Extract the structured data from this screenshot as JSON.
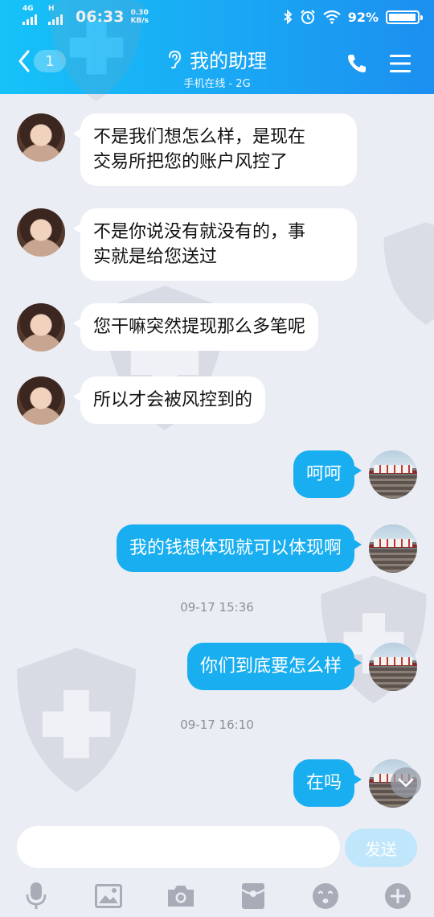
{
  "status_bar": {
    "network_type": "4G",
    "network_hd": "H",
    "time": "06:33",
    "speed_value": "0.30",
    "speed_unit": "KB/s",
    "battery_percent": "92%"
  },
  "header": {
    "back_badge": "1",
    "title": "我的助理",
    "subtitle": "手机在线 - 2G"
  },
  "messages": [
    {
      "side": "in",
      "text": "不是我们想怎么样，是现在\n交易所把您的账户风控了"
    },
    {
      "side": "in",
      "text": "不是你说没有就没有的，事\n实就是给您送过"
    },
    {
      "side": "in",
      "text": "您干嘛突然提现那么多笔呢"
    },
    {
      "side": "in",
      "text": "所以才会被风控到的"
    },
    {
      "side": "out",
      "text": "呵呵"
    },
    {
      "side": "out",
      "text": "我的钱想体现就可以体现啊"
    },
    {
      "side": "out",
      "text": "你们到底要怎么样"
    },
    {
      "side": "out",
      "text": "在吗"
    }
  ],
  "timestamps": [
    "09-17 15:36",
    "09-17 16:10"
  ],
  "input": {
    "value": "",
    "placeholder": "",
    "send_label": "发送"
  },
  "toolbar_icons": [
    "microphone-icon",
    "image-icon",
    "camera-icon",
    "red-packet-icon",
    "emoji-icon",
    "plus-icon"
  ],
  "colors": {
    "header_start": "#16c2f8",
    "header_end": "#1c8ff0",
    "outgoing_bubble": "#18aef0",
    "incoming_bubble": "#ffffff",
    "background": "#ebedf5",
    "send_button": "#bfe6fb"
  }
}
